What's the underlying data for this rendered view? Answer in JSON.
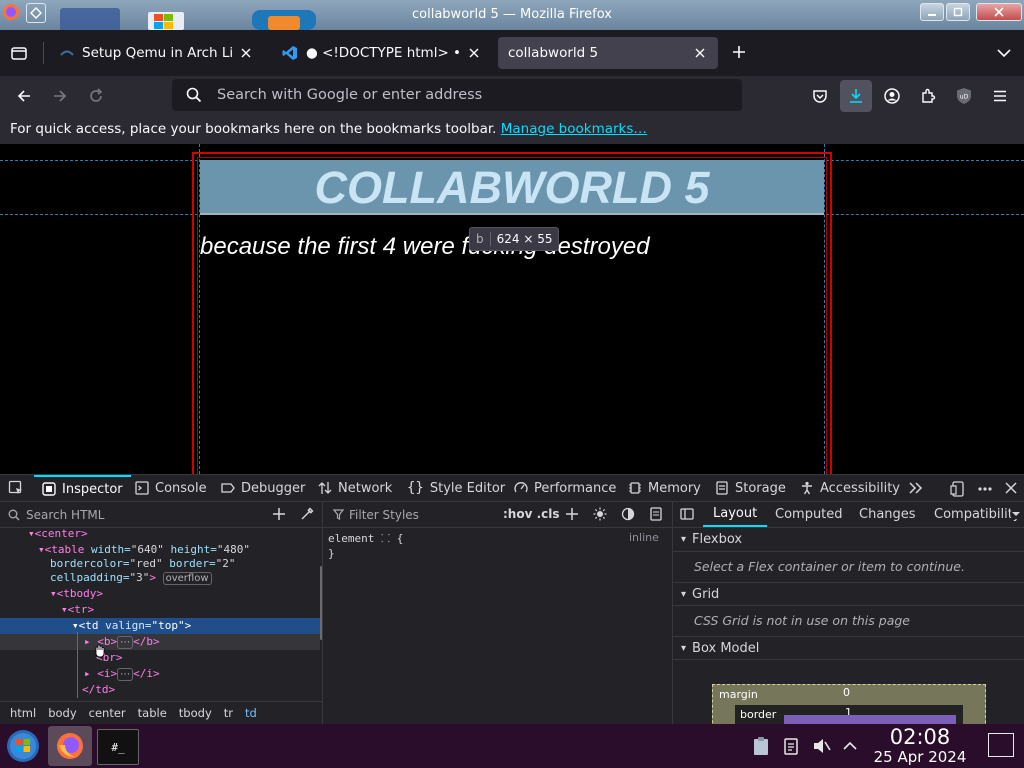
{
  "window": {
    "title": "collabworld 5 — Mozilla Firefox"
  },
  "tabs": [
    {
      "label": "Setup Qemu in Arch Linu",
      "icon": "page-favicon-icon"
    },
    {
      "label": "● <!DOCTYPE html> • a",
      "icon": "vscode-icon"
    },
    {
      "label": "collabworld 5",
      "icon": "none",
      "active": true
    }
  ],
  "urlbar": {
    "placeholder": "Search with Google or enter address"
  },
  "bookmarks": {
    "message": "For quick access, place your bookmarks here on the bookmarks toolbar.",
    "link": "Manage bookmarks…"
  },
  "page": {
    "headline": "COLLABWORLD 5",
    "tagline": "because the first 4 were fucking destroyed",
    "tooltip": {
      "tag": "b",
      "size": "624 × 55"
    }
  },
  "devtools": {
    "tabs": [
      "Inspector",
      "Console",
      "Debugger",
      "Network",
      "Style Editor",
      "Performance",
      "Memory",
      "Storage",
      "Accessibility"
    ],
    "search_placeholder": "Search HTML",
    "filter_placeholder": "Filter Styles",
    "pseudo_toggle": ":hov .cls",
    "tree": {
      "center": "<center>",
      "table_open": "<table",
      "table_width_attr": "width=",
      "table_width_val": "\"640\"",
      "table_height_attr": "height=",
      "table_height_val": "\"480\"",
      "table_bordercolor_attr": "bordercolor=",
      "table_bordercolor_val": "\"red\"",
      "table_border_attr": "border=",
      "table_border_val": "\"2\"",
      "table_cellpadding_attr": "cellpadding=",
      "table_cellpadding_val": "\"3\"",
      "table_close": ">",
      "overflow_badge": "overflow",
      "tbody": "<tbody>",
      "tr": "<tr>",
      "td_open": "<td",
      "td_attr": "valign=",
      "td_val": "\"top\"",
      "td_close": ">",
      "b_open": "<b>",
      "b_close": "</b>",
      "br": "<br>",
      "i_open": "<i>",
      "i_close": "</i>",
      "td_end": "</td>",
      "ellipsis": "⋯"
    },
    "rule": {
      "selector": "element",
      "open": "{",
      "close": "}",
      "source": "inline"
    },
    "breadcrumbs": [
      "html",
      "body",
      "center",
      "table",
      "tbody",
      "tr",
      "td"
    ],
    "layout_tabs": [
      "Layout",
      "Computed",
      "Changes",
      "Compatibility"
    ],
    "flexbox": {
      "title": "Flexbox",
      "message": "Select a Flex container or item to continue."
    },
    "grid": {
      "title": "Grid",
      "message": "CSS Grid is not in use on this page"
    },
    "boxmodel": {
      "title": "Box Model",
      "margin_label": "margin",
      "border_label": "border",
      "margin_value": "0",
      "border_value": "1"
    }
  },
  "taskbar": {
    "time": "02:08",
    "date": "25 Apr 2024",
    "terminal_label": "#_"
  },
  "colors": {
    "accent": "#00ddff",
    "selection": "#204e8a",
    "page_border": "#d40000",
    "headline_bg": "#6b95ac",
    "taskbar": "#2a0d2a"
  }
}
